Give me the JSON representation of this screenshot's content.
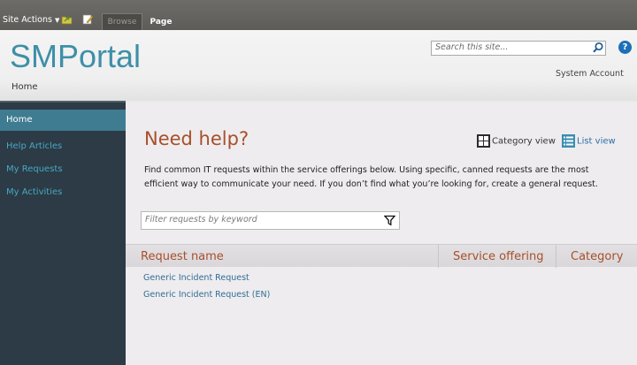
{
  "ribbon": {
    "site_actions": "Site Actions",
    "tabs": [
      {
        "label": "Browse"
      },
      {
        "label": "Page"
      }
    ]
  },
  "header": {
    "logo": "SMPortal",
    "breadcrumb": "Home",
    "search_placeholder": "Search this site...",
    "user": "System Account",
    "help_glyph": "?"
  },
  "sidebar": {
    "items": [
      {
        "label": "Home",
        "active": true
      },
      {
        "label": "Help Articles"
      },
      {
        "label": "My Requests"
      },
      {
        "label": "My Activities"
      }
    ]
  },
  "main": {
    "title": "Need help?",
    "category_view": "Category view",
    "list_view": "List view",
    "intro": "Find common IT requests within the service offerings below.  Using specific, canned requests are the most efficient way to communicate your need. If you don’t find what you’re looking for, create a general request.",
    "filter_placeholder": "Filter requests by keyword",
    "columns": [
      "Request name",
      "Service offering",
      "Category"
    ],
    "rows": [
      "Generic Incident Request",
      "Generic Incident Request (EN)"
    ]
  },
  "colors": {
    "accent": "#3e8fa8",
    "title": "#a6502a",
    "sidebar_bg": "#2c3b45",
    "sidebar_active": "#3f7c91",
    "link": "#2e6f94"
  }
}
